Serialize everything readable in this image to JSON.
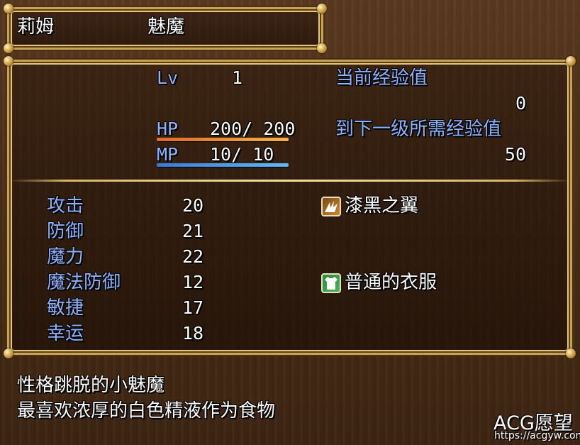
{
  "header": {
    "name": "莉姆",
    "class": "魅魔"
  },
  "status": {
    "level_label": "Lv",
    "level_value": "1",
    "hp_label": "HP",
    "hp_value": "200/ 200",
    "hp_fraction": 1.0,
    "mp_label": "MP",
    "mp_value": "10/  10",
    "mp_fraction": 1.0,
    "exp_current_label": "当前经验值",
    "exp_current_value": "0",
    "exp_next_label": "到下一级所需经验值",
    "exp_next_value": "50"
  },
  "params": [
    {
      "label": "攻击",
      "value": "20"
    },
    {
      "label": "防御",
      "value": "21"
    },
    {
      "label": "魔力",
      "value": "22"
    },
    {
      "label": "魔法防御",
      "value": "12"
    },
    {
      "label": "敏捷",
      "value": "17"
    },
    {
      "label": "幸运",
      "value": "18"
    }
  ],
  "equipment": [
    {
      "icon": "dark-wing-icon",
      "name": "漆黑之翼"
    },
    {
      "icon": "clothes-icon",
      "name": "普通的衣服"
    }
  ],
  "description": {
    "line1": "性格跳脱的小魅魔",
    "line2": "最喜欢浓厚的白色精液作为食物"
  },
  "watermark": {
    "brand": "ACG愿望",
    "url": "https://acgyw.com"
  },
  "colors": {
    "label_blue": "#8fb4ff",
    "hp_gauge": "#f0a040",
    "mp_gauge": "#4aa0f0",
    "frame_gold": "#c9a25a"
  }
}
